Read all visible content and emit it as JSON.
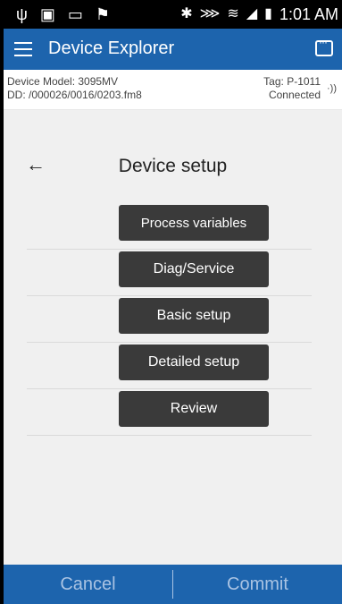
{
  "status_bar": {
    "left_icons": [
      "usb-icon",
      "sim-icon",
      "image-icon",
      "flag-icon"
    ],
    "right_icons": [
      "bluetooth-icon",
      "vibrate-icon",
      "wifi-icon",
      "signal-icon",
      "battery-icon"
    ],
    "time": "1:01 AM"
  },
  "app_bar": {
    "title": "Device Explorer"
  },
  "info_bar": {
    "device_model": "Device Model: 3095MV",
    "dd": "DD: /000026/0016/0203.fm8",
    "tag": "Tag: P-1011",
    "status": "Connected"
  },
  "page": {
    "title": "Device setup"
  },
  "menu": [
    {
      "label": "Process variables"
    },
    {
      "label": "Diag/Service"
    },
    {
      "label": "Basic setup"
    },
    {
      "label": "Detailed setup"
    },
    {
      "label": "Review"
    }
  ],
  "bottom_bar": {
    "cancel_label": "Cancel",
    "commit_label": "Commit"
  },
  "colors": {
    "brand_blue": "#1d64ad",
    "button_dark": "#3a3a3a"
  }
}
